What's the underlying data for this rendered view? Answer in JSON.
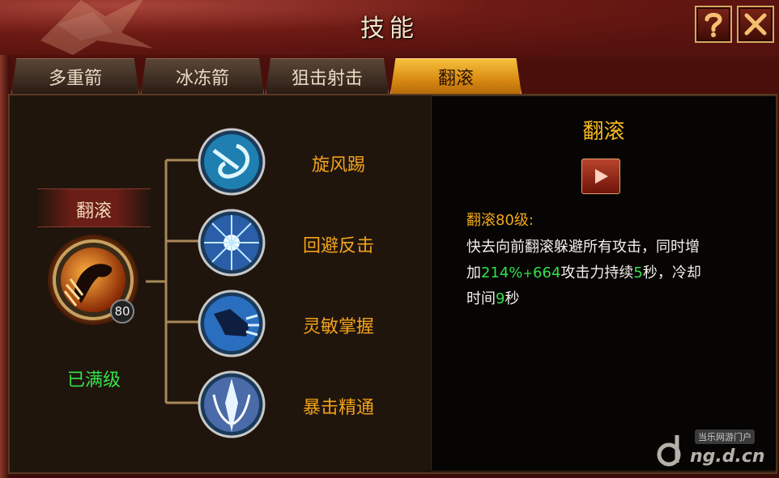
{
  "window": {
    "title": "技能",
    "help_icon": "question-mark-icon",
    "close_icon": "close-x-icon"
  },
  "tabs": [
    {
      "label": "多重箭",
      "active": false
    },
    {
      "label": "冰冻箭",
      "active": false
    },
    {
      "label": "狙击射击",
      "active": false
    },
    {
      "label": "翻滚",
      "active": true
    }
  ],
  "main_skill": {
    "name": "翻滚",
    "level": "80",
    "status": "已满级",
    "icon": "tumble-skill-icon"
  },
  "sub_skills": [
    {
      "label": "旋风踢",
      "icon": "whirlwind-kick-icon"
    },
    {
      "label": "回避反击",
      "icon": "evade-counter-icon"
    },
    {
      "label": "灵敏掌握",
      "icon": "agility-mastery-icon"
    },
    {
      "label": "暴击精通",
      "icon": "critical-mastery-icon"
    }
  ],
  "detail": {
    "title": "翻滚",
    "play_icon": "play-icon",
    "head_name": "翻滚",
    "head_level": "80级:",
    "line1": "快去向前翻滚躲避所有攻击，同时增",
    "line2_a": "加",
    "line2_pct": "214%",
    "line2_plus": "+",
    "line2_val": "664",
    "line2_b": "攻击力持续",
    "line2_sec": "5",
    "line2_c": "秒，冷却",
    "line3_a": "时间",
    "line3_sec": "9",
    "line3_b": "秒"
  },
  "watermark": {
    "tag": "当乐网游门户",
    "text": "ng.d.cn"
  },
  "colors": {
    "accent_gold": "#f3a21a",
    "maxed_green": "#34e04a",
    "title_cream": "#f6e4c8"
  }
}
